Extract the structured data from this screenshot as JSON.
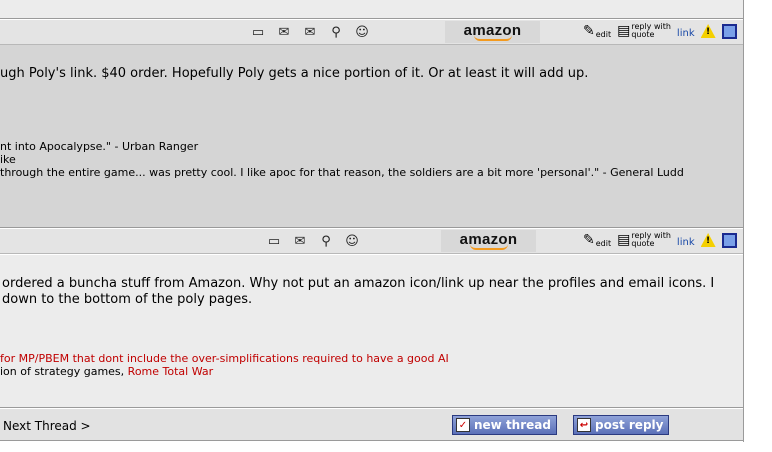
{
  "post1": {
    "amazon_label": "amazon",
    "edit_label": "edit",
    "reply_label": "reply with",
    "quote_label": "quote",
    "link_label": "link",
    "message_line1": "ugh Poly's link. $40 order. Hopefully Poly gets a nice portion of it. Or at least it will add up.",
    "sig_line1": "nt into Apocalypse.\" - Urban Ranger",
    "sig_line2": "ike",
    "sig_line3": "through the entire game... was pretty cool. I like apoc for that reason, the soldiers are a bit more 'personal'.\" - General Ludd"
  },
  "post2": {
    "amazon_label": "amazon",
    "edit_label": "edit",
    "reply_label": "reply with",
    "quote_label": "quote",
    "link_label": "link",
    "message_line1": "ordered a buncha stuff from Amazon. Why not put an amazon icon/link up near the profiles and email icons. I",
    "message_line2": "down to the bottom of the poly pages.",
    "sig_line1": "for MP/PBEM that dont include the over-simplifications required to have a good AI",
    "sig_line2_prefix": "ion of strategy games,",
    "sig_line2_link": "Rome Total War"
  },
  "footer": {
    "next_thread": "Next Thread >",
    "new_thread": "new thread",
    "post_reply": "post reply"
  },
  "colors": {
    "post_bg_dark": "#d5d5d5",
    "post_bg_light": "#ececec",
    "link_blue": "#1a4aa8",
    "signature_red": "#c00000",
    "button_blue": "#5b70b8"
  }
}
